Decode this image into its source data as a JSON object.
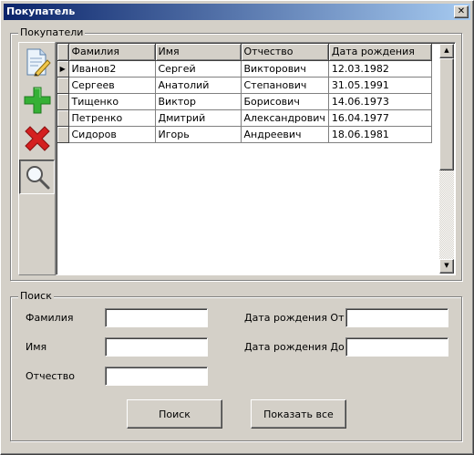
{
  "window": {
    "title": "Покупатель",
    "close_glyph": "✕"
  },
  "customers_group": {
    "legend": "Покупатели",
    "toolbar": {
      "edit_icon": "edit-document-icon",
      "add_icon": "plus-icon",
      "delete_icon": "delete-x-icon",
      "search_icon": "magnifier-icon"
    },
    "grid": {
      "columns": [
        "Фамилия",
        "Имя",
        "Отчество",
        "Дата рождения"
      ],
      "current_row_marker": "▶",
      "rows": [
        [
          "Иванов2",
          "Сергей",
          "Викторович",
          "12.03.1982"
        ],
        [
          "Сергеев",
          "Анатолий",
          "Степанович",
          "31.05.1991"
        ],
        [
          "Тищенко",
          "Виктор",
          "Борисович",
          "14.06.1973"
        ],
        [
          "Петренко",
          "Дмитрий",
          "Александрович",
          "16.04.1977"
        ],
        [
          "Сидоров",
          "Игорь",
          "Андреевич",
          "18.06.1981"
        ]
      ]
    },
    "scroll_up_glyph": "▲",
    "scroll_down_glyph": "▼"
  },
  "search_group": {
    "legend": "Поиск",
    "surname_label": "Фамилия",
    "surname_value": "",
    "name_label": "Имя",
    "name_value": "",
    "patronymic_label": "Отчество",
    "patronymic_value": "",
    "birth_from_label": "Дата рождения От",
    "birth_from_value": "",
    "birth_to_label": "Дата рождения До",
    "birth_to_value": "",
    "search_button": "Поиск",
    "show_all_button": "Показать все"
  },
  "colors": {
    "title_gradient_start": "#0a246a",
    "title_gradient_end": "#a6caf0",
    "face": "#d4d0c8",
    "add_icon": "#2fa52f",
    "delete_icon": "#d42020"
  }
}
